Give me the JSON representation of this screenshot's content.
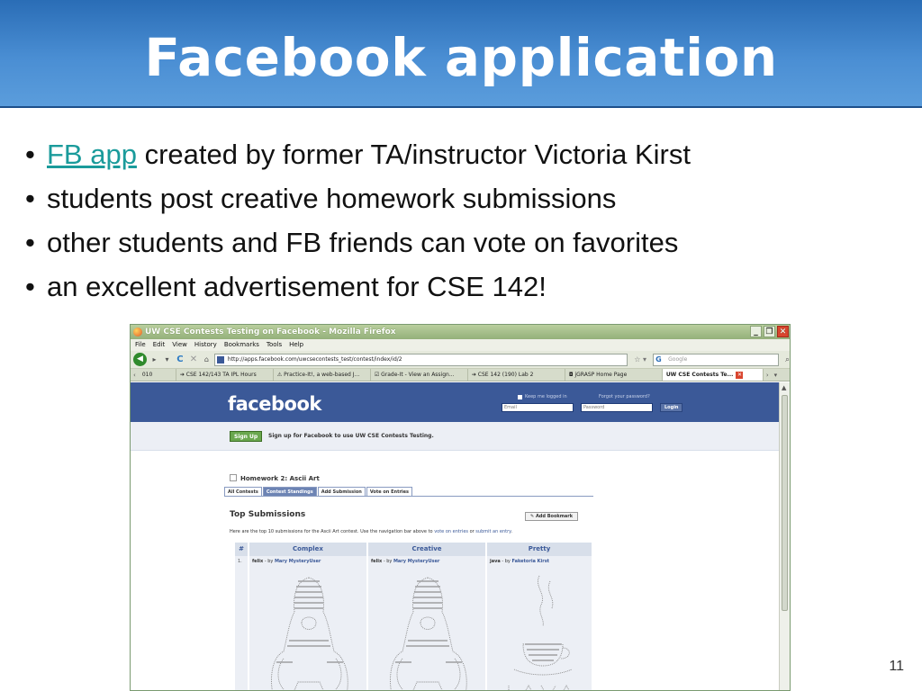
{
  "slide": {
    "title": "Facebook application",
    "bullets": [
      {
        "link": "FB app",
        "text": " created by former TA/instructor Victoria Kirst"
      },
      {
        "text": "students post creative homework submissions"
      },
      {
        "text": "other students and FB friends can vote on favorites"
      },
      {
        "text": "an excellent advertisement for CSE 142!"
      }
    ],
    "page_number": "11"
  },
  "browser": {
    "window_title": "UW CSE Contests Testing on Facebook - Mozilla Firefox",
    "window_buttons": [
      "_",
      "❐",
      "✕"
    ],
    "menu": [
      "File",
      "Edit",
      "View",
      "History",
      "Bookmarks",
      "Tools",
      "Help"
    ],
    "url": "http://apps.facebook.com/uwcsecontests_test/contest/index/id/2",
    "search_placeholder": "Google",
    "tabs": [
      {
        "label": "010"
      },
      {
        "label": "CSE 142/143 TA IPL Hours"
      },
      {
        "label": "Practice-It!, a web-based J..."
      },
      {
        "label": "Grade-It - View an Assign..."
      },
      {
        "label": "CSE 142 (190) Lab 2"
      },
      {
        "label": "jGRASP Home Page"
      },
      {
        "label": "UW CSE Contests Te...",
        "active": true
      }
    ]
  },
  "facebook": {
    "logo": "facebook",
    "keep_logged_in": "Keep me logged in",
    "forgot_password": "Forgot your password?",
    "email_placeholder": "Email",
    "password_placeholder": "Password",
    "login_label": "Login",
    "signup_button": "Sign Up",
    "signup_text": "Sign up for Facebook to use UW CSE Contests Testing.",
    "app_title": "Homework 2: Ascii Art",
    "app_tabs": [
      {
        "label": "All Contests"
      },
      {
        "label": "Contest Standings",
        "active": true
      },
      {
        "label": "Add Submission"
      },
      {
        "label": "Vote on Entries"
      }
    ],
    "top_submissions": "Top Submissions",
    "add_bookmark": "Add Bookmark",
    "description_prefix": "Here are the top 10 submissions for the Ascii Art contest. Use the navigation bar above to ",
    "description_link1": "vote on entries",
    "description_mid": " or ",
    "description_link2": "submit an entry",
    "description_suffix": ".",
    "table": {
      "headers": [
        "#",
        "Complex",
        "Creative",
        "Pretty"
      ],
      "rows": [
        {
          "num": "1.",
          "entries": [
            {
              "name": "felix",
              "by": " - by ",
              "user": "Mary MysteryUser"
            },
            {
              "name": "felix",
              "by": " - by ",
              "user": "Mary MysteryUser"
            },
            {
              "name": "java",
              "by": " - by ",
              "user": "Faketoria Kirst"
            }
          ]
        }
      ]
    }
  }
}
